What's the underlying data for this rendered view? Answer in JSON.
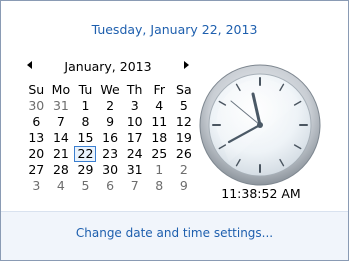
{
  "header": {
    "full_date": "Tuesday, January 22, 2013"
  },
  "calendar": {
    "month_label": "January, 2013",
    "weekdays": [
      "Su",
      "Mo",
      "Tu",
      "We",
      "Th",
      "Fr",
      "Sa"
    ],
    "weeks": [
      [
        "30",
        "31",
        "1",
        "2",
        "3",
        "4",
        "5"
      ],
      [
        "6",
        "7",
        "8",
        "9",
        "10",
        "11",
        "12"
      ],
      [
        "13",
        "14",
        "15",
        "16",
        "17",
        "18",
        "19"
      ],
      [
        "20",
        "21",
        "22",
        "23",
        "24",
        "25",
        "26"
      ],
      [
        "27",
        "28",
        "29",
        "30",
        "31",
        "1",
        "2"
      ],
      [
        "3",
        "4",
        "5",
        "6",
        "7",
        "8",
        "9"
      ]
    ],
    "today": "22"
  },
  "clock": {
    "time": "11:38:52 AM"
  },
  "footer": {
    "link_text": "Change date and time settings..."
  },
  "colors": {
    "accent": "#1e5fae",
    "today_border": "#3b7fd0",
    "footer_bg": "#f1f5fb"
  }
}
